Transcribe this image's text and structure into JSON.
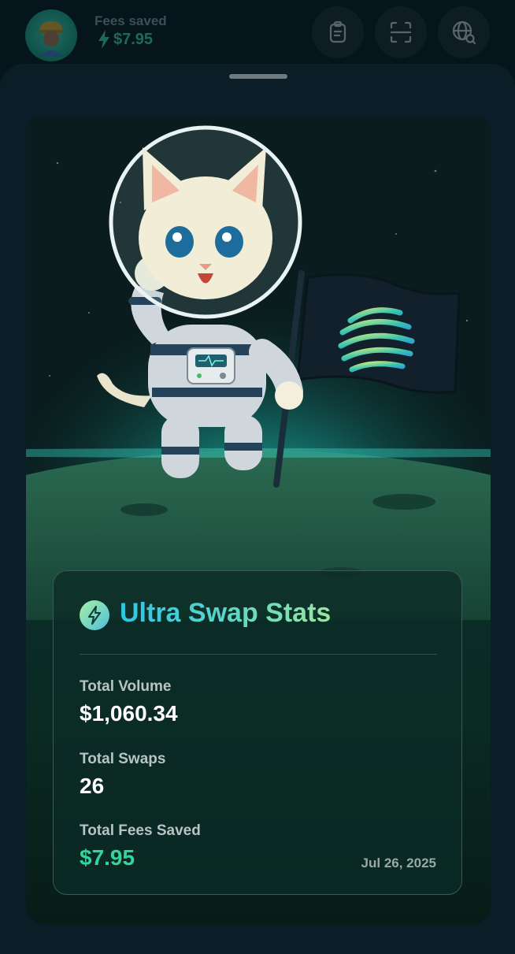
{
  "header": {
    "fees_label": "Fees saved",
    "fees_value": "$7.95",
    "icons": [
      "clipboard-icon",
      "scan-icon",
      "globe-search-icon"
    ]
  },
  "stats": {
    "title": "Ultra Swap Stats",
    "total_volume_label": "Total Volume",
    "total_volume_value": "$1,060.34",
    "total_swaps_label": "Total Swaps",
    "total_swaps_value": "26",
    "total_fees_label": "Total Fees Saved",
    "total_fees_value": "$7.95",
    "date": "Jul 26, 2025"
  },
  "colors": {
    "accent_green": "#35d49a",
    "title_gradient_start": "#2fc4e6",
    "title_gradient_end": "#9ae6a0"
  }
}
